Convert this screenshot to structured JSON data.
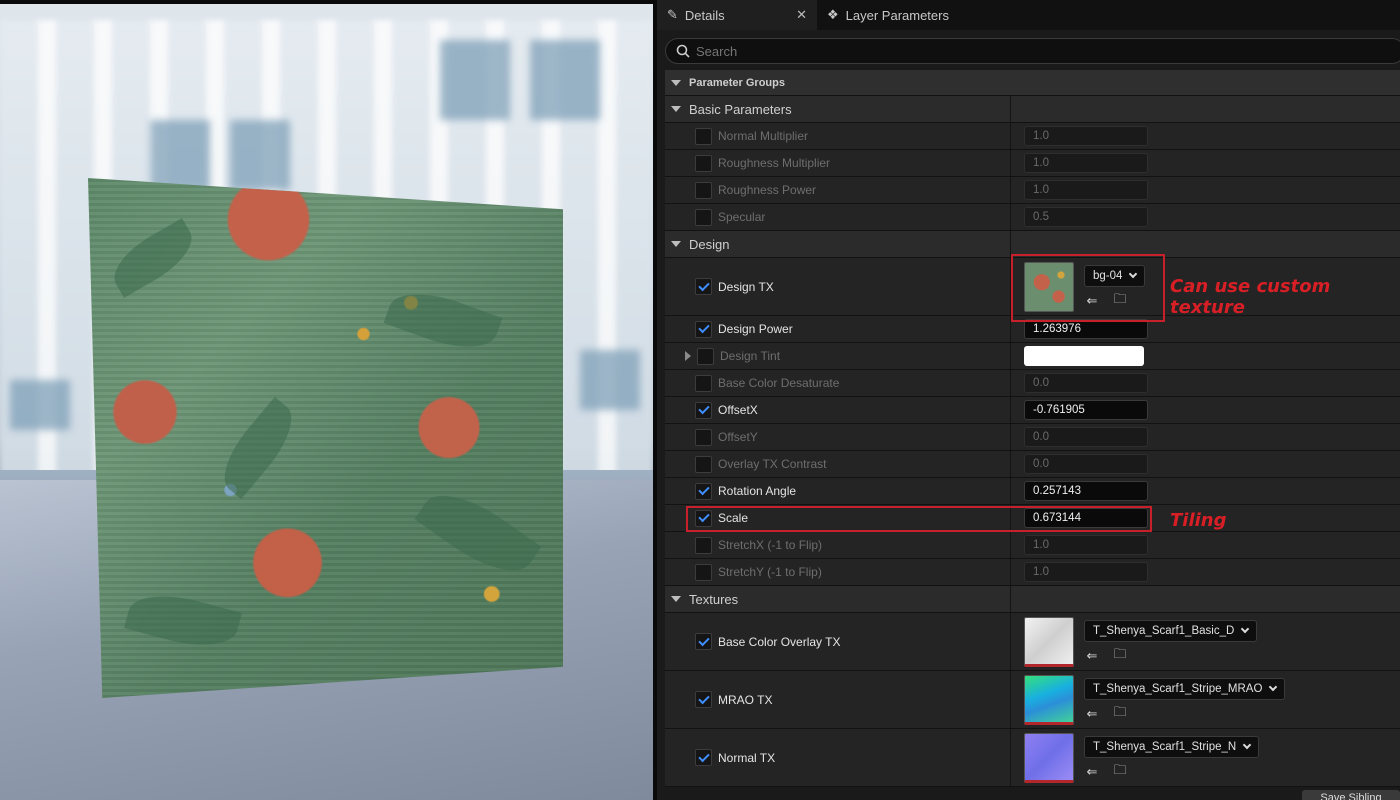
{
  "tabs": [
    {
      "label": "Details",
      "icon": "pencil-icon"
    },
    {
      "label": "Layer Parameters",
      "icon": "layers-icon"
    }
  ],
  "search": {
    "placeholder": "Search"
  },
  "header": {
    "label": "Parameter Groups"
  },
  "groups": {
    "basic": {
      "label": "Basic Parameters",
      "params": [
        {
          "name": "Normal Multiplier",
          "value": "1.0",
          "enabled": false
        },
        {
          "name": "Roughness Multiplier",
          "value": "1.0",
          "enabled": false
        },
        {
          "name": "Roughness Power",
          "value": "1.0",
          "enabled": false
        },
        {
          "name": "Specular",
          "value": "0.5",
          "enabled": false
        }
      ]
    },
    "design": {
      "label": "Design",
      "design_tx": {
        "name": "Design TX",
        "enabled": true,
        "asset": "bg-04"
      },
      "params": [
        {
          "name": "Design Power",
          "value": "1.263976",
          "enabled": true
        },
        {
          "name": "Design Tint",
          "value": "",
          "enabled": false
        },
        {
          "name": "Base Color Desaturate",
          "value": "0.0",
          "enabled": false
        },
        {
          "name": "OffsetX",
          "value": "-0.761905",
          "enabled": true
        },
        {
          "name": "OffsetY",
          "value": "0.0",
          "enabled": false
        },
        {
          "name": "Overlay TX Contrast",
          "value": "0.0",
          "enabled": false
        },
        {
          "name": "Rotation Angle",
          "value": "0.257143",
          "enabled": true
        },
        {
          "name": "Scale",
          "value": "0.673144",
          "enabled": true
        },
        {
          "name": "StretchX (-1 to Flip)",
          "value": "1.0",
          "enabled": false
        },
        {
          "name": "StretchY (-1 to Flip)",
          "value": "1.0",
          "enabled": false
        }
      ]
    },
    "textures": {
      "label": "Textures",
      "items": [
        {
          "name": "Base Color Overlay TX",
          "enabled": true,
          "asset": "T_Shenya_Scarf1_Basic_D"
        },
        {
          "name": "MRAO TX",
          "enabled": true,
          "asset": "T_Shenya_Scarf1_Stripe_MRAO"
        },
        {
          "name": "Normal TX",
          "enabled": true,
          "asset": "T_Shenya_Scarf1_Stripe_N"
        }
      ]
    }
  },
  "annotations": {
    "custom_texture": "Can use custom texture",
    "tiling": "Tiling"
  },
  "footer": {
    "save_label": "Save Sibling"
  },
  "colors": {
    "accent": "#3f8fff",
    "annotation": "#d91f26"
  }
}
